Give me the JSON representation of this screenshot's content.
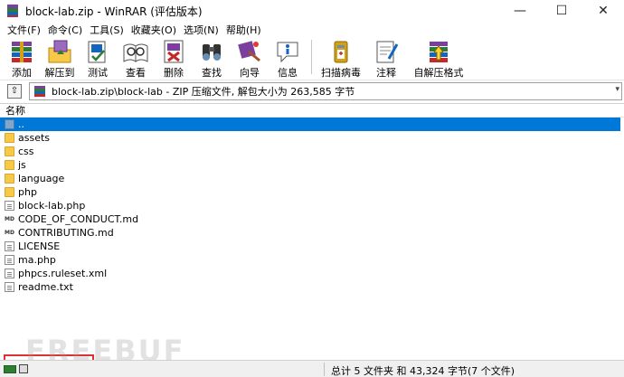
{
  "window": {
    "title": "block-lab.zip - WinRAR (评估版本)",
    "minimize_glyph": "—",
    "maximize_glyph": "☐",
    "close_glyph": "✕"
  },
  "menu": [
    "文件(F)",
    "命令(C)",
    "工具(S)",
    "收藏夹(O)",
    "选项(N)",
    "帮助(H)"
  ],
  "toolbar": [
    {
      "label": "添加",
      "icon": "add-archive-icon"
    },
    {
      "label": "解压到",
      "icon": "extract-to-icon"
    },
    {
      "label": "测试",
      "icon": "test-icon"
    },
    {
      "label": "查看",
      "icon": "view-icon"
    },
    {
      "label": "删除",
      "icon": "delete-icon"
    },
    {
      "label": "查找",
      "icon": "find-icon"
    },
    {
      "label": "向导",
      "icon": "wizard-icon"
    },
    {
      "label": "信息",
      "icon": "info-icon"
    },
    {
      "label": "扫描病毒",
      "icon": "virus-scan-icon"
    },
    {
      "label": "注释",
      "icon": "comment-icon"
    },
    {
      "label": "自解压格式",
      "icon": "sfx-icon"
    }
  ],
  "address": {
    "up_glyph": "⇧",
    "path": "block-lab.zip\\block-lab - ZIP 压缩文件, 解包大小为 263,585 字节",
    "dropdown_glyph": "▾"
  },
  "list": {
    "header": "名称",
    "rows": [
      {
        "name": "..",
        "type": "up",
        "selected": true
      },
      {
        "name": "assets",
        "type": "folder"
      },
      {
        "name": "css",
        "type": "folder"
      },
      {
        "name": "js",
        "type": "folder"
      },
      {
        "name": "language",
        "type": "folder"
      },
      {
        "name": "php",
        "type": "folder"
      },
      {
        "name": "block-lab.php",
        "type": "file"
      },
      {
        "name": "CODE_OF_CONDUCT.md",
        "type": "md"
      },
      {
        "name": "CONTRIBUTING.md",
        "type": "md"
      },
      {
        "name": "LICENSE",
        "type": "file"
      },
      {
        "name": "ma.php",
        "type": "file",
        "highlighted": true
      },
      {
        "name": "phpcs.ruleset.xml",
        "type": "file"
      },
      {
        "name": "readme.txt",
        "type": "file"
      }
    ]
  },
  "status": {
    "summary": "总计 5 文件夹 和 43,324 字节(7 个文件)"
  },
  "watermark": "FREEBUF",
  "colors": {
    "selection": "#0078d7",
    "highlight_border": "#e03131",
    "folder": "#f7c948"
  }
}
